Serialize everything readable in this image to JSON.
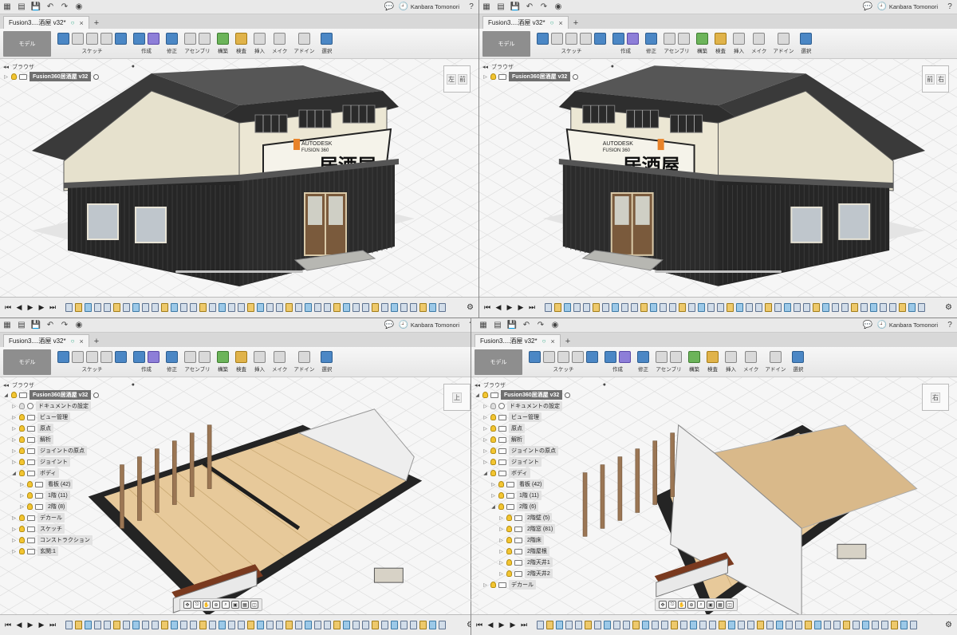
{
  "panes": [
    {
      "tab_title": "Fusion3....酒屋 v32*",
      "user": "Kanbara Tomonori",
      "workspace": "モデル",
      "tool_groups": [
        "スケッチ",
        "作成",
        "修正",
        "アセンブリ",
        "構築",
        "検査",
        "挿入",
        "メイク",
        "アドイン",
        "選択"
      ],
      "browser_label": "ブラウザ",
      "root": "Fusion360居酒屋 v32",
      "tree": [],
      "viewcube": [
        "左",
        "前"
      ],
      "sign_text": "居酒屋",
      "sign_brand_top": "AUTODESK",
      "sign_brand_bottom": "FUSION 360",
      "view": "exterior-left"
    },
    {
      "tab_title": "Fusion3....酒屋 v32*",
      "user": "Kanbara Tomonori",
      "workspace": "モデル",
      "tool_groups": [
        "スケッチ",
        "作成",
        "修正",
        "アセンブリ",
        "構築",
        "検査",
        "挿入",
        "メイク",
        "アドイン",
        "選択"
      ],
      "browser_label": "ブラウザ",
      "root": "Fusion360居酒屋 v32",
      "tree": [],
      "viewcube": [
        "前",
        "右"
      ],
      "sign_text": "居酒屋",
      "sign_brand_top": "AUTODESK",
      "sign_brand_bottom": "FUSION 360",
      "view": "exterior-right"
    },
    {
      "tab_title": "Fusion3....酒屋 v32*",
      "user": "Kanbara Tomonori",
      "workspace": "モデル",
      "tool_groups": [
        "スケッチ",
        "作成",
        "修正",
        "アセンブリ",
        "構築",
        "検査",
        "挿入",
        "メイク",
        "アドイン",
        "選択"
      ],
      "browser_label": "ブラウザ",
      "root": "Fusion360居酒屋 v32",
      "tree": [
        {
          "label": "ドキュメントの設定",
          "indent": 1,
          "icon": "gear"
        },
        {
          "label": "ビュー管理",
          "indent": 1,
          "icon": "folder"
        },
        {
          "label": "原点",
          "indent": 1,
          "icon": "folder"
        },
        {
          "label": "解析",
          "indent": 1,
          "icon": "folder"
        },
        {
          "label": "ジョイントの原点",
          "indent": 1,
          "icon": "folder"
        },
        {
          "label": "ジョイント",
          "indent": 1,
          "icon": "folder"
        },
        {
          "label": "ボディ",
          "indent": 1,
          "icon": "folder",
          "open": true
        },
        {
          "label": "看板 (42)",
          "indent": 2,
          "icon": "folder"
        },
        {
          "label": "1階 (11)",
          "indent": 2,
          "icon": "folder"
        },
        {
          "label": "2階 (8)",
          "indent": 2,
          "icon": "folder"
        },
        {
          "label": "デカール",
          "indent": 1,
          "icon": "folder"
        },
        {
          "label": "スケッチ",
          "indent": 1,
          "icon": "folder"
        },
        {
          "label": "コンストラクション",
          "indent": 1,
          "icon": "folder"
        },
        {
          "label": "玄関:1",
          "indent": 1,
          "icon": "component"
        }
      ],
      "viewcube": [
        "上"
      ],
      "view": "interior-1f"
    },
    {
      "tab_title": "Fusion3....酒屋 v32*",
      "user": "Kanbara Tomonori",
      "workspace": "モデル",
      "tool_groups": [
        "スケッチ",
        "作成",
        "修正",
        "アセンブリ",
        "構築",
        "検査",
        "挿入",
        "メイク",
        "アドイン",
        "選択"
      ],
      "browser_label": "ブラウザ",
      "root": "Fusion360居酒屋 v32",
      "tree": [
        {
          "label": "ドキュメントの設定",
          "indent": 1,
          "icon": "gear"
        },
        {
          "label": "ビュー管理",
          "indent": 1,
          "icon": "folder"
        },
        {
          "label": "原点",
          "indent": 1,
          "icon": "folder"
        },
        {
          "label": "解析",
          "indent": 1,
          "icon": "folder"
        },
        {
          "label": "ジョイントの原点",
          "indent": 1,
          "icon": "folder"
        },
        {
          "label": "ジョイント",
          "indent": 1,
          "icon": "folder"
        },
        {
          "label": "ボディ",
          "indent": 1,
          "icon": "folder",
          "open": true
        },
        {
          "label": "看板 (42)",
          "indent": 2,
          "icon": "folder"
        },
        {
          "label": "1階 (11)",
          "indent": 2,
          "icon": "folder"
        },
        {
          "label": "2階 (6)",
          "indent": 2,
          "icon": "folder",
          "open": true
        },
        {
          "label": "2階壁 (5)",
          "indent": 3,
          "icon": "folder"
        },
        {
          "label": "2階窓 (81)",
          "indent": 3,
          "icon": "folder"
        },
        {
          "label": "2階床",
          "indent": 3,
          "icon": "body"
        },
        {
          "label": "2階屋根",
          "indent": 3,
          "icon": "body"
        },
        {
          "label": "2階天井1",
          "indent": 3,
          "icon": "body"
        },
        {
          "label": "2階天井2",
          "indent": 3,
          "icon": "body"
        },
        {
          "label": "デカール",
          "indent": 1,
          "icon": "folder"
        }
      ],
      "viewcube": [
        "右"
      ],
      "view": "interior-2f"
    }
  ]
}
